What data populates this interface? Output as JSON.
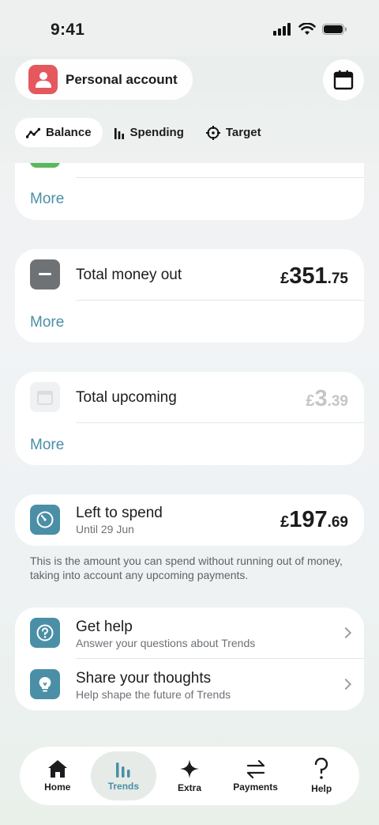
{
  "status_bar": {
    "time": "9:41"
  },
  "header": {
    "account_label": "Personal account",
    "tabs": [
      {
        "label": "Balance",
        "icon": "line-chart-icon",
        "active": true
      },
      {
        "label": "Spending",
        "icon": "bar-chart-icon",
        "active": false
      },
      {
        "label": "Target",
        "icon": "target-icon",
        "active": false
      }
    ]
  },
  "cards": {
    "top_partial": {
      "more": "More"
    },
    "money_out": {
      "title": "Total money out",
      "currency": "£",
      "amount_main": "351",
      "amount_dec": ".75",
      "more": "More"
    },
    "upcoming": {
      "title": "Total upcoming",
      "currency": "£",
      "amount_main": "3",
      "amount_dec": ".39",
      "more": "More"
    },
    "left_to_spend": {
      "title": "Left to spend",
      "subtitle": "Until 29 Jun",
      "currency": "£",
      "amount_main": "197",
      "amount_dec": ".69"
    }
  },
  "note": "This is the amount you can spend without running out of money, taking into account any upcoming payments.",
  "help": {
    "items": [
      {
        "title": "Get help",
        "subtitle": "Answer your questions about Trends"
      },
      {
        "title": "Share your thoughts",
        "subtitle": "Help shape the future of Trends"
      }
    ]
  },
  "bottom_nav": {
    "items": [
      {
        "label": "Home",
        "icon": "home-icon",
        "active": false
      },
      {
        "label": "Trends",
        "icon": "trends-icon",
        "active": true
      },
      {
        "label": "Extra",
        "icon": "sparkle-icon",
        "active": false
      },
      {
        "label": "Payments",
        "icon": "transfer-icon",
        "active": false
      },
      {
        "label": "Help",
        "icon": "question-icon",
        "active": false
      }
    ]
  },
  "colors": {
    "accent": "#4a8fa6",
    "avatar": "#e4585e",
    "money_out_icon": "#6f7275",
    "speed_icon": "#4a8fa6",
    "muted_amount": "#c3c5c8"
  }
}
